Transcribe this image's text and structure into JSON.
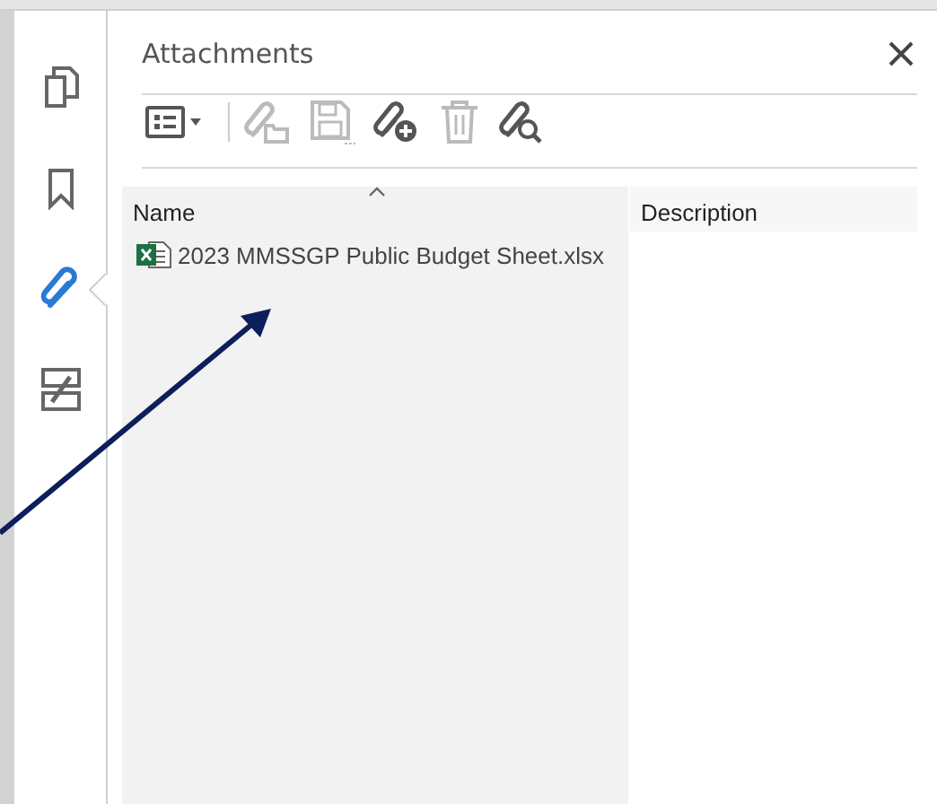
{
  "sidebar": {
    "items": [
      {
        "kind": "pages",
        "selected": false
      },
      {
        "kind": "bookmarks",
        "selected": false
      },
      {
        "kind": "attachments",
        "selected": true
      },
      {
        "kind": "compare",
        "selected": false
      }
    ]
  },
  "panel": {
    "title": "Attachments",
    "toolbar": [
      {
        "kind": "options",
        "disabled": false
      },
      {
        "kind": "open",
        "disabled": true
      },
      {
        "kind": "save",
        "disabled": true
      },
      {
        "kind": "add",
        "disabled": false
      },
      {
        "kind": "delete",
        "disabled": true
      },
      {
        "kind": "search",
        "disabled": false
      }
    ],
    "table": {
      "columns": [
        {
          "label": "Name",
          "sorted": true
        },
        {
          "label": "Description",
          "sorted": false
        }
      ],
      "rows": [
        {
          "name": "2023 MMSSGP Public Budget Sheet.xlsx",
          "description": ""
        }
      ]
    }
  },
  "annotation": {
    "kind": "arrow"
  }
}
